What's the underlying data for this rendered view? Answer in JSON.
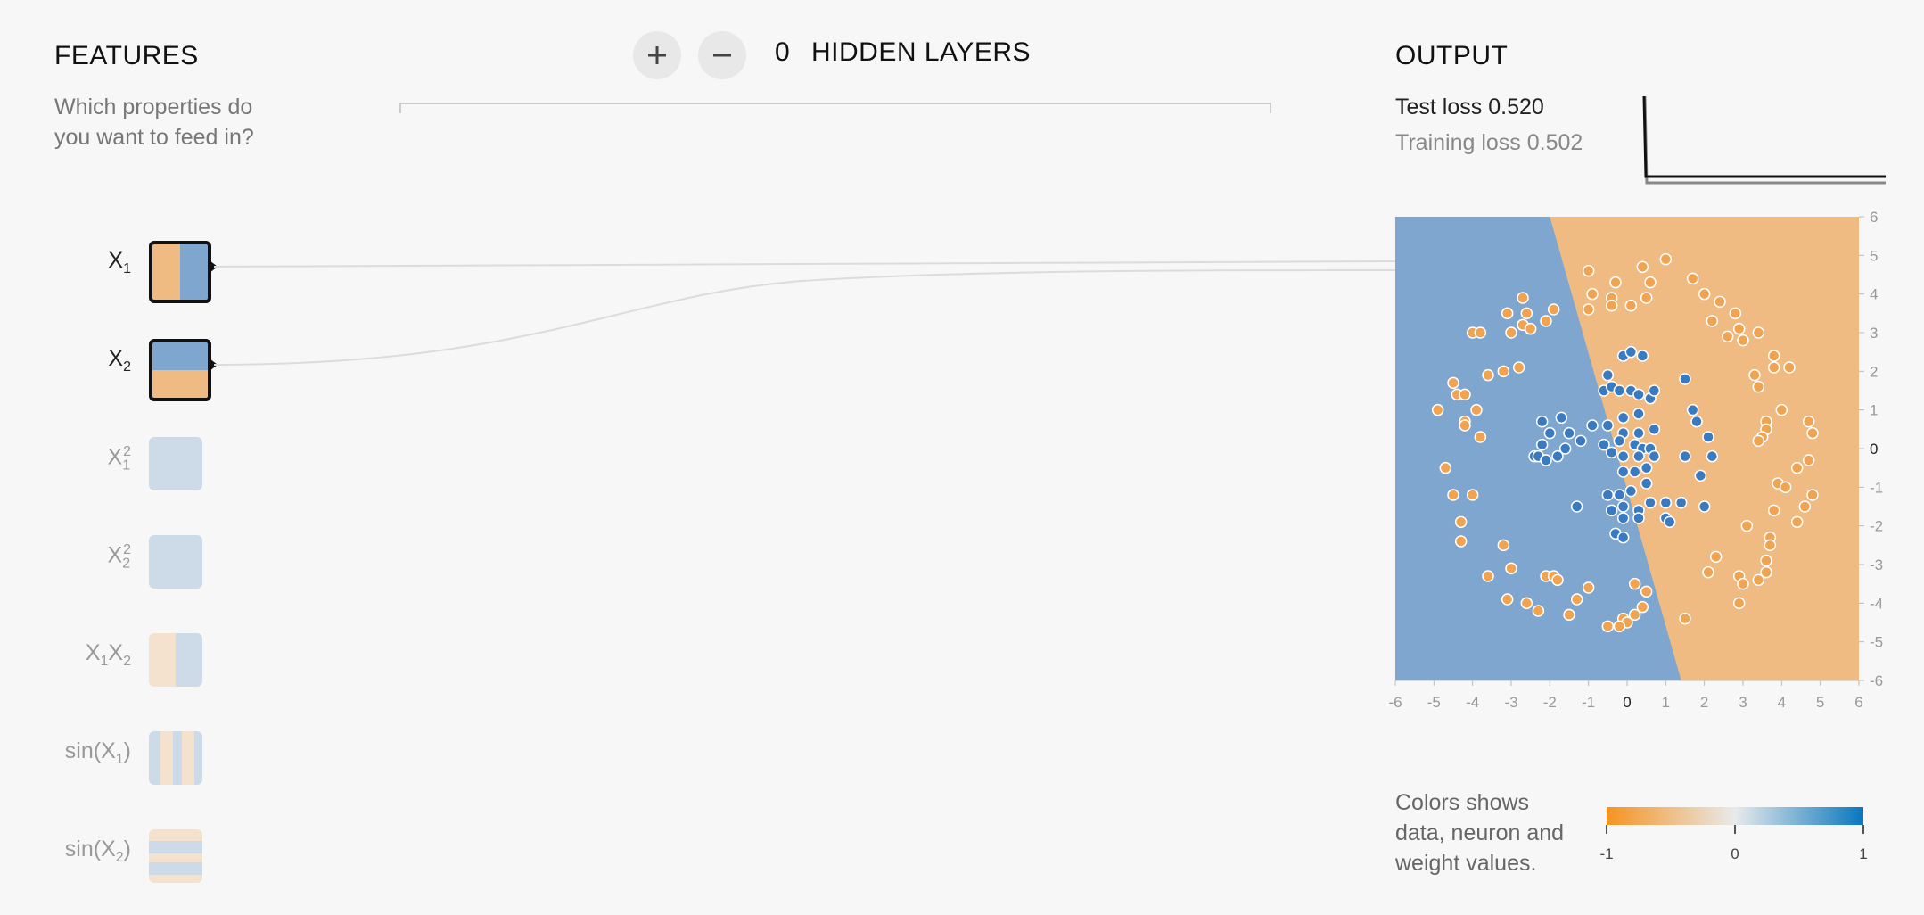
{
  "features": {
    "title": "FEATURES",
    "subtitle_line1": "Which properties do",
    "subtitle_line2": "you want to feed in?",
    "items": [
      {
        "base": "X",
        "sub": "1",
        "sup": "",
        "active": true
      },
      {
        "base": "X",
        "sub": "2",
        "sup": "",
        "active": true
      },
      {
        "base": "X",
        "sub": "1",
        "sup": "2",
        "active": false
      },
      {
        "base": "X",
        "sub": "2",
        "sup": "2",
        "active": false
      },
      {
        "base": "X",
        "sub": "1",
        "base2": "X",
        "sub2": "2",
        "active": false
      },
      {
        "prefix": "sin(X",
        "sub": "1",
        "suffix": ")",
        "active": false
      },
      {
        "prefix": "sin(X",
        "sub": "2",
        "suffix": ")",
        "active": false
      }
    ]
  },
  "layers": {
    "add_icon": "plus-icon",
    "remove_icon": "minus-icon",
    "count": "0",
    "label": "HIDDEN LAYERS"
  },
  "output": {
    "title": "OUTPUT",
    "test_loss_label": "Test loss",
    "test_loss_value": "0.520",
    "training_loss_label": "Training loss",
    "training_loss_value": "0.502"
  },
  "legend": {
    "line1": "Colors shows",
    "line2": "data, neuron and",
    "line3": "weight values.",
    "min": "-1",
    "mid": "0",
    "max": "1",
    "color_neg": "#f59322",
    "color_pos": "#0877bd"
  },
  "colors": {
    "orange_region": "#efbb82",
    "blue_region": "#7ea6ce",
    "orange_point": "#f0a452",
    "blue_point": "#3a7ac0"
  },
  "chart_data": {
    "type": "scatter",
    "title": "",
    "xlim": [
      -6,
      6
    ],
    "ylim": [
      -6,
      6
    ],
    "x_ticks": [
      "-6",
      "-5",
      "-4",
      "-3",
      "-2",
      "-1",
      "0",
      "1",
      "2",
      "3",
      "4",
      "5",
      "6"
    ],
    "y_ticks": [
      "6",
      "5",
      "4",
      "3",
      "2",
      "1",
      "0",
      "-1",
      "-2",
      "-3",
      "-4",
      "-5",
      "-6"
    ],
    "decision_boundary": [
      [
        -2.0,
        6
      ],
      [
        1.4,
        -6
      ]
    ],
    "series": [
      {
        "class": "blue",
        "points": [
          [
            -0.1,
            2.4
          ],
          [
            0.1,
            2.5
          ],
          [
            0.4,
            2.4
          ],
          [
            -0.5,
            1.9
          ],
          [
            1.5,
            1.8
          ],
          [
            -0.6,
            1.5
          ],
          [
            -0.4,
            1.6
          ],
          [
            -0.2,
            1.5
          ],
          [
            0.1,
            1.5
          ],
          [
            0.3,
            1.4
          ],
          [
            0.6,
            1.3
          ],
          [
            0.7,
            1.5
          ],
          [
            -2.2,
            0.7
          ],
          [
            -1.7,
            0.8
          ],
          [
            -0.1,
            0.8
          ],
          [
            0.3,
            0.9
          ],
          [
            1.7,
            1.0
          ],
          [
            -2.0,
            0.4
          ],
          [
            -1.5,
            0.4
          ],
          [
            -1.2,
            0.2
          ],
          [
            -0.9,
            0.6
          ],
          [
            -0.5,
            0.6
          ],
          [
            -0.1,
            0.4
          ],
          [
            0.3,
            0.4
          ],
          [
            0.7,
            0.5
          ],
          [
            1.8,
            0.7
          ],
          [
            2.1,
            0.3
          ],
          [
            -2.2,
            0.1
          ],
          [
            -1.6,
            0.0
          ],
          [
            -0.6,
            0.1
          ],
          [
            -0.2,
            0.2
          ],
          [
            0.2,
            0.1
          ],
          [
            0.4,
            0.0
          ],
          [
            0.6,
            0.0
          ],
          [
            -2.4,
            -0.2
          ],
          [
            -2.3,
            -0.2
          ],
          [
            -2.1,
            -0.3
          ],
          [
            -1.8,
            -0.2
          ],
          [
            -0.4,
            -0.1
          ],
          [
            -0.1,
            -0.2
          ],
          [
            0.3,
            -0.2
          ],
          [
            0.7,
            -0.2
          ],
          [
            1.5,
            -0.2
          ],
          [
            2.2,
            -0.2
          ],
          [
            -0.1,
            -0.6
          ],
          [
            0.2,
            -0.6
          ],
          [
            0.5,
            -0.5
          ],
          [
            1.9,
            -0.7
          ],
          [
            -0.2,
            -1.2
          ],
          [
            0.1,
            -1.1
          ],
          [
            0.5,
            -0.9
          ],
          [
            -0.5,
            -1.2
          ],
          [
            -1.3,
            -1.5
          ],
          [
            -0.4,
            -1.6
          ],
          [
            -0.1,
            -1.5
          ],
          [
            0.3,
            -1.6
          ],
          [
            0.6,
            -1.4
          ],
          [
            1.0,
            -1.4
          ],
          [
            1.4,
            -1.4
          ],
          [
            2.0,
            -1.5
          ],
          [
            -0.1,
            -1.8
          ],
          [
            0.3,
            -1.8
          ],
          [
            1.0,
            -1.8
          ],
          [
            1.1,
            -1.9
          ],
          [
            -0.3,
            -2.2
          ],
          [
            -0.1,
            -2.3
          ]
        ]
      },
      {
        "class": "orange",
        "points": [
          [
            -1.0,
            4.6
          ],
          [
            0.4,
            4.7
          ],
          [
            1.0,
            4.9
          ],
          [
            -0.3,
            4.3
          ],
          [
            0.6,
            4.3
          ],
          [
            1.7,
            4.4
          ],
          [
            -0.9,
            4.0
          ],
          [
            -0.4,
            3.9
          ],
          [
            0.5,
            3.9
          ],
          [
            2.0,
            4.0
          ],
          [
            -2.7,
            3.9
          ],
          [
            -0.4,
            3.7
          ],
          [
            0.1,
            3.7
          ],
          [
            2.4,
            3.8
          ],
          [
            -1.9,
            3.6
          ],
          [
            -3.1,
            3.5
          ],
          [
            -2.6,
            3.5
          ],
          [
            -1.0,
            3.6
          ],
          [
            2.8,
            3.5
          ],
          [
            -2.7,
            3.2
          ],
          [
            -2.1,
            3.3
          ],
          [
            2.2,
            3.3
          ],
          [
            2.9,
            3.1
          ],
          [
            -4.0,
            3.0
          ],
          [
            -3.8,
            3.0
          ],
          [
            -3.0,
            3.0
          ],
          [
            -2.5,
            3.1
          ],
          [
            2.6,
            2.9
          ],
          [
            3.4,
            3.0
          ],
          [
            3.0,
            2.8
          ],
          [
            3.8,
            2.4
          ],
          [
            3.8,
            2.1
          ],
          [
            4.2,
            2.1
          ],
          [
            -2.8,
            2.1
          ],
          [
            -3.2,
            2.0
          ],
          [
            -3.6,
            1.9
          ],
          [
            3.3,
            1.9
          ],
          [
            3.4,
            1.6
          ],
          [
            -4.5,
            1.7
          ],
          [
            -4.4,
            1.4
          ],
          [
            -4.2,
            1.4
          ],
          [
            -4.9,
            1.0
          ],
          [
            -3.9,
            1.0
          ],
          [
            4.0,
            1.0
          ],
          [
            -4.2,
            0.7
          ],
          [
            -4.2,
            0.6
          ],
          [
            3.6,
            0.7
          ],
          [
            4.7,
            0.7
          ],
          [
            3.6,
            0.5
          ],
          [
            4.8,
            0.4
          ],
          [
            -3.8,
            0.3
          ],
          [
            3.5,
            0.3
          ],
          [
            3.4,
            0.2
          ],
          [
            4.7,
            -0.3
          ],
          [
            4.4,
            -0.5
          ],
          [
            -4.7,
            -0.5
          ],
          [
            3.9,
            -0.9
          ],
          [
            4.1,
            -1.0
          ],
          [
            -4.5,
            -1.2
          ],
          [
            -4.0,
            -1.2
          ],
          [
            4.8,
            -1.2
          ],
          [
            3.8,
            -1.6
          ],
          [
            4.6,
            -1.5
          ],
          [
            -4.3,
            -1.9
          ],
          [
            3.1,
            -2.0
          ],
          [
            4.4,
            -1.9
          ],
          [
            -4.3,
            -2.4
          ],
          [
            3.7,
            -2.3
          ],
          [
            -3.2,
            -2.5
          ],
          [
            3.7,
            -2.5
          ],
          [
            2.3,
            -2.8
          ],
          [
            3.6,
            -2.9
          ],
          [
            -3.0,
            -3.1
          ],
          [
            2.1,
            -3.2
          ],
          [
            3.6,
            -3.2
          ],
          [
            -3.6,
            -3.3
          ],
          [
            -2.1,
            -3.3
          ],
          [
            -1.9,
            -3.3
          ],
          [
            -1.8,
            -3.4
          ],
          [
            2.9,
            -3.3
          ],
          [
            3.0,
            -3.5
          ],
          [
            3.4,
            -3.4
          ],
          [
            0.2,
            -3.5
          ],
          [
            -1.0,
            -3.6
          ],
          [
            0.5,
            -3.7
          ],
          [
            -3.1,
            -3.9
          ],
          [
            -2.6,
            -4.0
          ],
          [
            -1.3,
            -3.9
          ],
          [
            0.4,
            -4.1
          ],
          [
            2.9,
            -4.0
          ],
          [
            -2.3,
            -4.2
          ],
          [
            -1.5,
            -4.3
          ],
          [
            -0.1,
            -4.4
          ],
          [
            0.0,
            -4.5
          ],
          [
            0.2,
            -4.3
          ],
          [
            1.5,
            -4.4
          ],
          [
            -0.5,
            -4.6
          ],
          [
            -0.2,
            -4.6
          ]
        ]
      }
    ]
  }
}
